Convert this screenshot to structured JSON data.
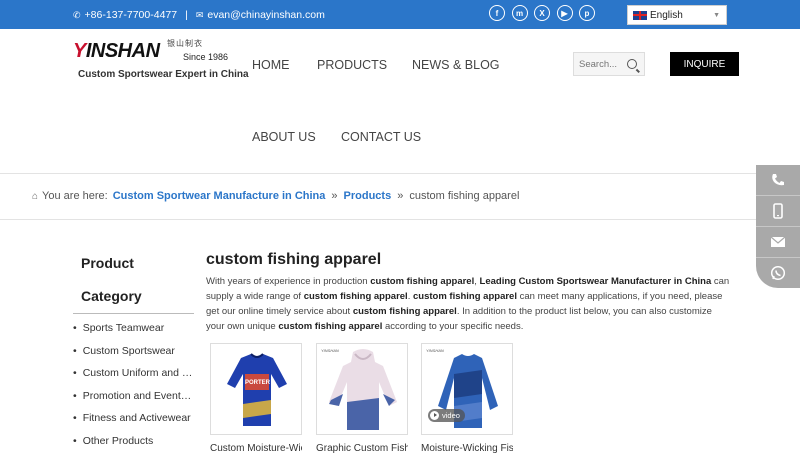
{
  "topbar": {
    "phone": "+86-137-7700-4477",
    "separator": "|",
    "email": "evan@chinayinshan.com",
    "social": [
      {
        "icon": "facebook-icon",
        "glyph": "f"
      },
      {
        "icon": "messenger-icon",
        "glyph": "m"
      },
      {
        "icon": "x-twitter-icon",
        "glyph": "X"
      },
      {
        "icon": "youtube-icon",
        "glyph": "▶"
      },
      {
        "icon": "pinterest-icon",
        "glyph": "p"
      }
    ],
    "language": "English"
  },
  "header": {
    "logo_word": "INSHAN",
    "logo_letter": "Y",
    "logo_cn": "银山制衣",
    "since": "Since 1986",
    "slogan": "Custom Sportswear Expert in China",
    "nav": {
      "home": "HOME",
      "products": "PRODUCTS",
      "news": "NEWS & BLOG",
      "about": "ABOUT US",
      "contact": "CONTACT US"
    },
    "search_placeholder": "Search...",
    "inquire": "INQUIRE"
  },
  "breadcrumb": {
    "prefix": "You are here:",
    "items": [
      "Custom Sportwear Manufacture in China",
      "Products"
    ],
    "current": "custom fishing apparel",
    "arrow": "»"
  },
  "sidebar": {
    "title_line1": "Product",
    "title_line2": "Category",
    "items": [
      "Sports Teamwear",
      "Custom Sportswear",
      "Custom Uniform and Workwear",
      "Promotion and Event Wear",
      "Fitness and Activewear",
      "Other Products"
    ]
  },
  "main": {
    "title": "custom fishing apparel",
    "desc": {
      "t1": "With years of experience in production ",
      "b1": "custom fishing apparel",
      "t2": ", ",
      "b2": "Leading Custom Sportswear Manufacturer in China",
      "t3": " can supply a wide range of ",
      "b3": "custom fishing apparel",
      "t4": ". ",
      "b4": "custom fishing apparel",
      "t5": " can meet many applications, if you need, please get our online timely service about ",
      "b5": "custom fishing apparel",
      "t6": ". In addition to the product list below, you can also customize your own unique ",
      "b6": "custom fishing apparel",
      "t7": " according to your specific needs."
    },
    "products": [
      {
        "label": "Custom Moisture-Wicking Fishing Shirt",
        "brand": "",
        "print": "PORTER",
        "color": "#1f3fae",
        "video": ""
      },
      {
        "label": "Graphic Custom Fishing Hoodie",
        "brand": "YINSHAN",
        "print": "",
        "color": "#e9dbe6",
        "video": ""
      },
      {
        "label": "Moisture-Wicking Fishing Jersey",
        "brand": "YINSHAN",
        "print": "",
        "color": "#2f63b8",
        "video": "video"
      }
    ]
  },
  "float_bar": [
    "phone-icon",
    "mobile-icon",
    "email-icon",
    "whatsapp-icon"
  ]
}
